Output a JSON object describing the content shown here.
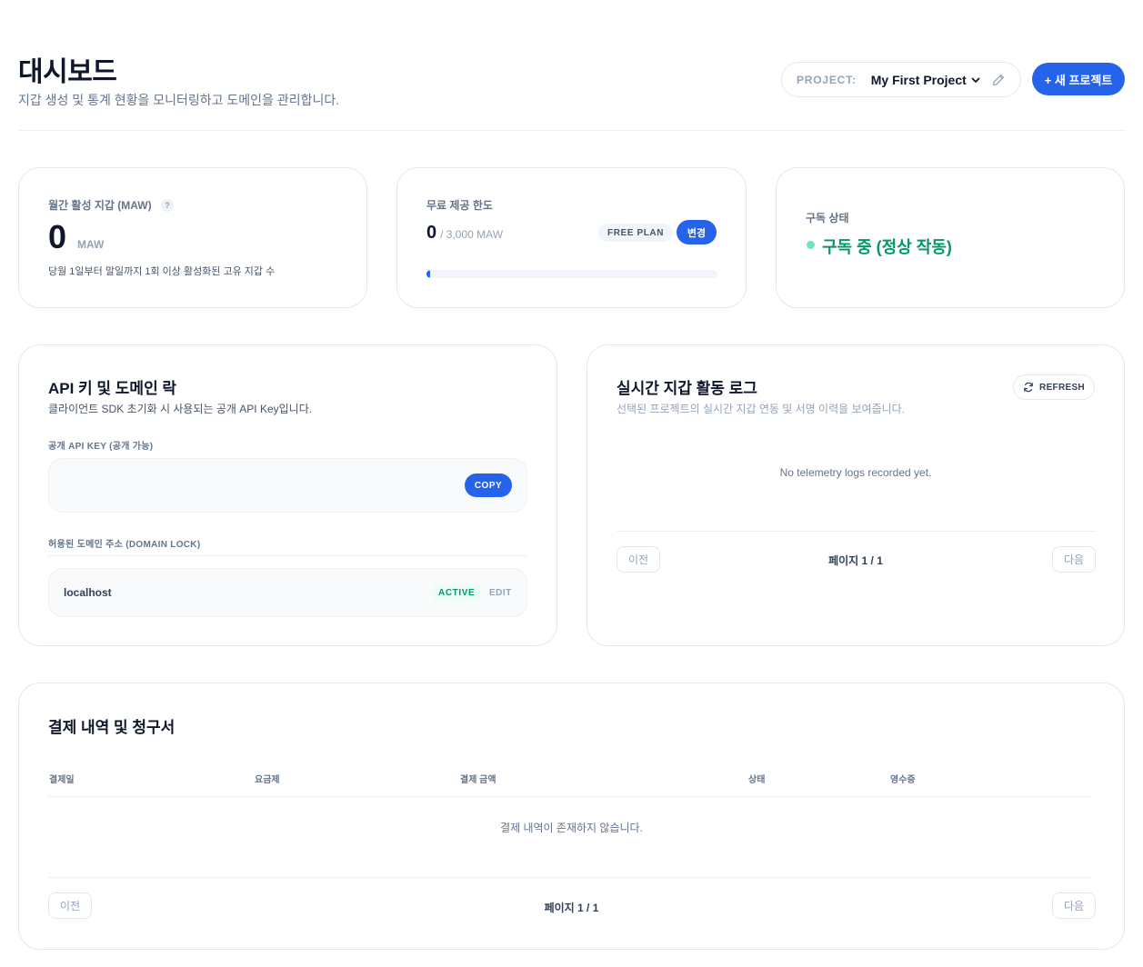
{
  "header": {
    "title": "대시보드",
    "subtitle": "지갑 생성 및 통계 현황을 모니터링하고 도메인을 관리합니다.",
    "project_label": "PROJECT:",
    "project_name": "My First Project",
    "new_project_label": "+ 새 프로젝트"
  },
  "stats": {
    "maw": {
      "label": "월간 활성 지갑 (MAW)",
      "help": "?",
      "value": "0",
      "unit": "MAW",
      "hint": "당월 1일부터 말일까지 1회 이상 활성화된 고유 지갑 수"
    },
    "free_quota": {
      "label": "무료 제공 한도",
      "used": "0",
      "total": "/ 3,000 MAW",
      "plan_badge": "FREE PLAN",
      "change_label": "변경",
      "progress_percent": 0
    },
    "subscription": {
      "label": "구독 상태",
      "status": "구독 중 (정상 작동)",
      "status_color": "#059669"
    }
  },
  "api_section": {
    "title": "API 키 및 도메인 락",
    "description": "클라이언트 SDK 초기화 시 사용되는 공개 API Key입니다.",
    "key_label": "공개 API KEY (공개 가능)",
    "key_value": "",
    "copy_label": "COPY",
    "domain_label": "허용된 도메인 주소 (DOMAIN LOCK)",
    "domains": [
      {
        "name": "localhost",
        "status": "ACTIVE",
        "edit_label": "EDIT"
      }
    ]
  },
  "activity_log": {
    "title": "실시간 지갑 활동 로그",
    "description": "선택된 프로젝트의 실시간 지갑 연동 및 서명 이력을 보여줍니다.",
    "refresh_label": "REFRESH",
    "empty_text": "No telemetry logs recorded yet.",
    "pagination": {
      "prev": "이전",
      "page": "페이지 1 / 1",
      "next": "다음"
    }
  },
  "billing": {
    "title": "결제 내역 및 청구서",
    "columns": [
      "결제일",
      "요금제",
      "결제 금액",
      "상태",
      "영수증"
    ],
    "empty_text": "결제 내역이 존재하지 않습니다.",
    "pagination": {
      "prev": "이전",
      "page": "페이지 1 / 1",
      "next": "다음"
    }
  },
  "colors": {
    "accent": "#2563eb",
    "success": "#059669",
    "success_dot": "#6ee7b7"
  }
}
